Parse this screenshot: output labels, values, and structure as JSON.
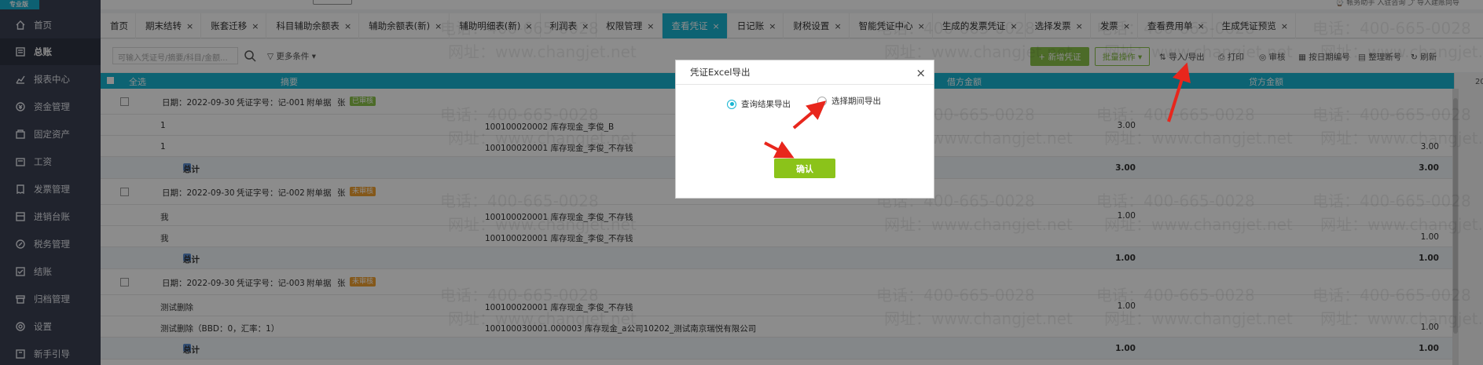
{
  "sidebar": {
    "brand": "专业版",
    "items": [
      {
        "label": "首页",
        "icon": "home-icon"
      },
      {
        "label": "总账",
        "icon": "ledger-icon"
      },
      {
        "label": "报表中心",
        "icon": "report-icon"
      },
      {
        "label": "资金管理",
        "icon": "money-icon"
      },
      {
        "label": "固定资产",
        "icon": "asset-icon"
      },
      {
        "label": "工资",
        "icon": "salary-icon"
      },
      {
        "label": "发票管理",
        "icon": "invoice-icon"
      },
      {
        "label": "进销台账",
        "icon": "inventory-icon"
      },
      {
        "label": "税务管理",
        "icon": "tax-icon"
      },
      {
        "label": "结账",
        "icon": "close-books-icon"
      },
      {
        "label": "归档管理",
        "icon": "archive-icon"
      },
      {
        "label": "设置",
        "icon": "settings-icon"
      },
      {
        "label": "新手引导",
        "icon": "guide-icon"
      }
    ]
  },
  "topbar": {
    "user_text": "⌚ 帐务助手  入驻咨询    ⤴ 导入建账向导"
  },
  "tabs": [
    {
      "label": "首页",
      "closable": false
    },
    {
      "label": "期末结转",
      "closable": true
    },
    {
      "label": "账套迁移",
      "closable": true
    },
    {
      "label": "科目辅助余额表",
      "closable": true
    },
    {
      "label": "辅助余额表(新)",
      "closable": true
    },
    {
      "label": "辅助明细表(新)",
      "closable": true
    },
    {
      "label": "利润表",
      "closable": true
    },
    {
      "label": "权限管理",
      "closable": true
    },
    {
      "label": "查看凭证",
      "closable": true,
      "active": true
    },
    {
      "label": "日记账",
      "closable": true
    },
    {
      "label": "财税设置",
      "closable": true
    },
    {
      "label": "智能凭证中心",
      "closable": true
    },
    {
      "label": "生成的发票凭证",
      "closable": true
    },
    {
      "label": "选择发票",
      "closable": true
    },
    {
      "label": "发票",
      "closable": true
    },
    {
      "label": "查看费用单",
      "closable": true
    },
    {
      "label": "生成凭证预览",
      "closable": true
    }
  ],
  "toolbar": {
    "search_placeholder": "可输入凭证号/摘要/科目/金额...",
    "filter_label": "▽ 更多条件 ▾",
    "new_voucher": "+ 新增凭证",
    "batch_ops": "批量操作 ▾",
    "import_export": "⇅ 导入/导出",
    "print": "⎙ 打印",
    "audit": "◎ 审核",
    "sort_by_date": "▦ 按日期编号",
    "renumber": "▤ 整理断号",
    "refresh": "↻ 刷新"
  },
  "table": {
    "headers": {
      "select_all": "全选",
      "summary": "摘要",
      "debit": "借方金额",
      "credit": "贷方金额"
    },
    "vouchers": [
      {
        "date": "日期：2022-09-30",
        "number": "凭证字号：记-001",
        "attachments": "附单据",
        "maker": "张",
        "status": "已审核",
        "status_color": "#8bc34a",
        "lines": [
          {
            "summary": "1",
            "account": "100100020002 库存现金_李俊_B",
            "debit": "3.00",
            "credit": ""
          },
          {
            "summary": "1",
            "account": "100100020001 库存现金_李俊_不存钱",
            "debit": "",
            "credit": "3.00"
          }
        ],
        "total_label": "总计",
        "total_debit": "3.00",
        "total_credit": "3.00"
      },
      {
        "date": "日期：2022-09-30",
        "number": "凭证字号：记-002",
        "attachments": "附单据",
        "maker": "张",
        "status": "未审核",
        "status_color": "#f0a030",
        "lines": [
          {
            "summary": "我",
            "account": "100100020001 库存现金_李俊_不存钱",
            "debit": "1.00",
            "credit": ""
          },
          {
            "summary": "我",
            "account": "100100020001 库存现金_李俊_不存钱",
            "debit": "",
            "credit": "1.00"
          }
        ],
        "total_label": "总计",
        "total_debit": "1.00",
        "total_credit": "1.00"
      },
      {
        "date": "日期：2022-09-30",
        "number": "凭证字号：记-003",
        "attachments": "附单据",
        "maker": "张",
        "status": "未审核",
        "status_color": "#f0a030",
        "lines": [
          {
            "summary": "测试删除",
            "account": "100100020001 库存现金_李俊_不存钱",
            "debit": "1.00",
            "credit": ""
          },
          {
            "summary": "测试删除（BBD：0，汇率：1）",
            "account": "100100030001.000003 库存现金_a公司10202_测试南京瑞悦有限公司",
            "debit": "",
            "credit": "1.00"
          }
        ],
        "total_label": "总计",
        "total_debit": "1.00",
        "total_credit": "1.00"
      }
    ]
  },
  "right_edge": {
    "top_label": "20"
  },
  "watermark": {
    "phone": "电话：400-665-0028",
    "site": "网址：www.changjet.net"
  },
  "dialog": {
    "title": "凭证Excel导出",
    "options": [
      {
        "label": "查询结果导出",
        "selected": true
      },
      {
        "label": "选择期间导出",
        "selected": false
      }
    ],
    "confirm": "确认"
  },
  "annotation_color": "#e8261c"
}
